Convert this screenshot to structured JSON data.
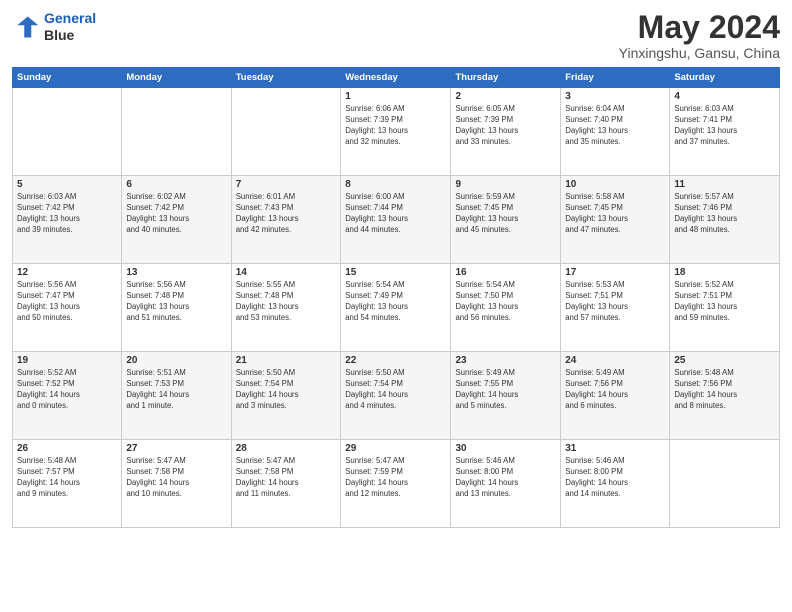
{
  "header": {
    "logo_line1": "General",
    "logo_line2": "Blue",
    "month": "May 2024",
    "location": "Yinxingshu, Gansu, China"
  },
  "weekdays": [
    "Sunday",
    "Monday",
    "Tuesday",
    "Wednesday",
    "Thursday",
    "Friday",
    "Saturday"
  ],
  "weeks": [
    [
      {
        "day": "",
        "info": ""
      },
      {
        "day": "",
        "info": ""
      },
      {
        "day": "",
        "info": ""
      },
      {
        "day": "1",
        "info": "Sunrise: 6:06 AM\nSunset: 7:39 PM\nDaylight: 13 hours\nand 32 minutes."
      },
      {
        "day": "2",
        "info": "Sunrise: 6:05 AM\nSunset: 7:39 PM\nDaylight: 13 hours\nand 33 minutes."
      },
      {
        "day": "3",
        "info": "Sunrise: 6:04 AM\nSunset: 7:40 PM\nDaylight: 13 hours\nand 35 minutes."
      },
      {
        "day": "4",
        "info": "Sunrise: 6:03 AM\nSunset: 7:41 PM\nDaylight: 13 hours\nand 37 minutes."
      }
    ],
    [
      {
        "day": "5",
        "info": "Sunrise: 6:03 AM\nSunset: 7:42 PM\nDaylight: 13 hours\nand 39 minutes."
      },
      {
        "day": "6",
        "info": "Sunrise: 6:02 AM\nSunset: 7:42 PM\nDaylight: 13 hours\nand 40 minutes."
      },
      {
        "day": "7",
        "info": "Sunrise: 6:01 AM\nSunset: 7:43 PM\nDaylight: 13 hours\nand 42 minutes."
      },
      {
        "day": "8",
        "info": "Sunrise: 6:00 AM\nSunset: 7:44 PM\nDaylight: 13 hours\nand 44 minutes."
      },
      {
        "day": "9",
        "info": "Sunrise: 5:59 AM\nSunset: 7:45 PM\nDaylight: 13 hours\nand 45 minutes."
      },
      {
        "day": "10",
        "info": "Sunrise: 5:58 AM\nSunset: 7:45 PM\nDaylight: 13 hours\nand 47 minutes."
      },
      {
        "day": "11",
        "info": "Sunrise: 5:57 AM\nSunset: 7:46 PM\nDaylight: 13 hours\nand 48 minutes."
      }
    ],
    [
      {
        "day": "12",
        "info": "Sunrise: 5:56 AM\nSunset: 7:47 PM\nDaylight: 13 hours\nand 50 minutes."
      },
      {
        "day": "13",
        "info": "Sunrise: 5:56 AM\nSunset: 7:48 PM\nDaylight: 13 hours\nand 51 minutes."
      },
      {
        "day": "14",
        "info": "Sunrise: 5:55 AM\nSunset: 7:48 PM\nDaylight: 13 hours\nand 53 minutes."
      },
      {
        "day": "15",
        "info": "Sunrise: 5:54 AM\nSunset: 7:49 PM\nDaylight: 13 hours\nand 54 minutes."
      },
      {
        "day": "16",
        "info": "Sunrise: 5:54 AM\nSunset: 7:50 PM\nDaylight: 13 hours\nand 56 minutes."
      },
      {
        "day": "17",
        "info": "Sunrise: 5:53 AM\nSunset: 7:51 PM\nDaylight: 13 hours\nand 57 minutes."
      },
      {
        "day": "18",
        "info": "Sunrise: 5:52 AM\nSunset: 7:51 PM\nDaylight: 13 hours\nand 59 minutes."
      }
    ],
    [
      {
        "day": "19",
        "info": "Sunrise: 5:52 AM\nSunset: 7:52 PM\nDaylight: 14 hours\nand 0 minutes."
      },
      {
        "day": "20",
        "info": "Sunrise: 5:51 AM\nSunset: 7:53 PM\nDaylight: 14 hours\nand 1 minute."
      },
      {
        "day": "21",
        "info": "Sunrise: 5:50 AM\nSunset: 7:54 PM\nDaylight: 14 hours\nand 3 minutes."
      },
      {
        "day": "22",
        "info": "Sunrise: 5:50 AM\nSunset: 7:54 PM\nDaylight: 14 hours\nand 4 minutes."
      },
      {
        "day": "23",
        "info": "Sunrise: 5:49 AM\nSunset: 7:55 PM\nDaylight: 14 hours\nand 5 minutes."
      },
      {
        "day": "24",
        "info": "Sunrise: 5:49 AM\nSunset: 7:56 PM\nDaylight: 14 hours\nand 6 minutes."
      },
      {
        "day": "25",
        "info": "Sunrise: 5:48 AM\nSunset: 7:56 PM\nDaylight: 14 hours\nand 8 minutes."
      }
    ],
    [
      {
        "day": "26",
        "info": "Sunrise: 5:48 AM\nSunset: 7:57 PM\nDaylight: 14 hours\nand 9 minutes."
      },
      {
        "day": "27",
        "info": "Sunrise: 5:47 AM\nSunset: 7:58 PM\nDaylight: 14 hours\nand 10 minutes."
      },
      {
        "day": "28",
        "info": "Sunrise: 5:47 AM\nSunset: 7:58 PM\nDaylight: 14 hours\nand 11 minutes."
      },
      {
        "day": "29",
        "info": "Sunrise: 5:47 AM\nSunset: 7:59 PM\nDaylight: 14 hours\nand 12 minutes."
      },
      {
        "day": "30",
        "info": "Sunrise: 5:46 AM\nSunset: 8:00 PM\nDaylight: 14 hours\nand 13 minutes."
      },
      {
        "day": "31",
        "info": "Sunrise: 5:46 AM\nSunset: 8:00 PM\nDaylight: 14 hours\nand 14 minutes."
      },
      {
        "day": "",
        "info": ""
      }
    ]
  ]
}
